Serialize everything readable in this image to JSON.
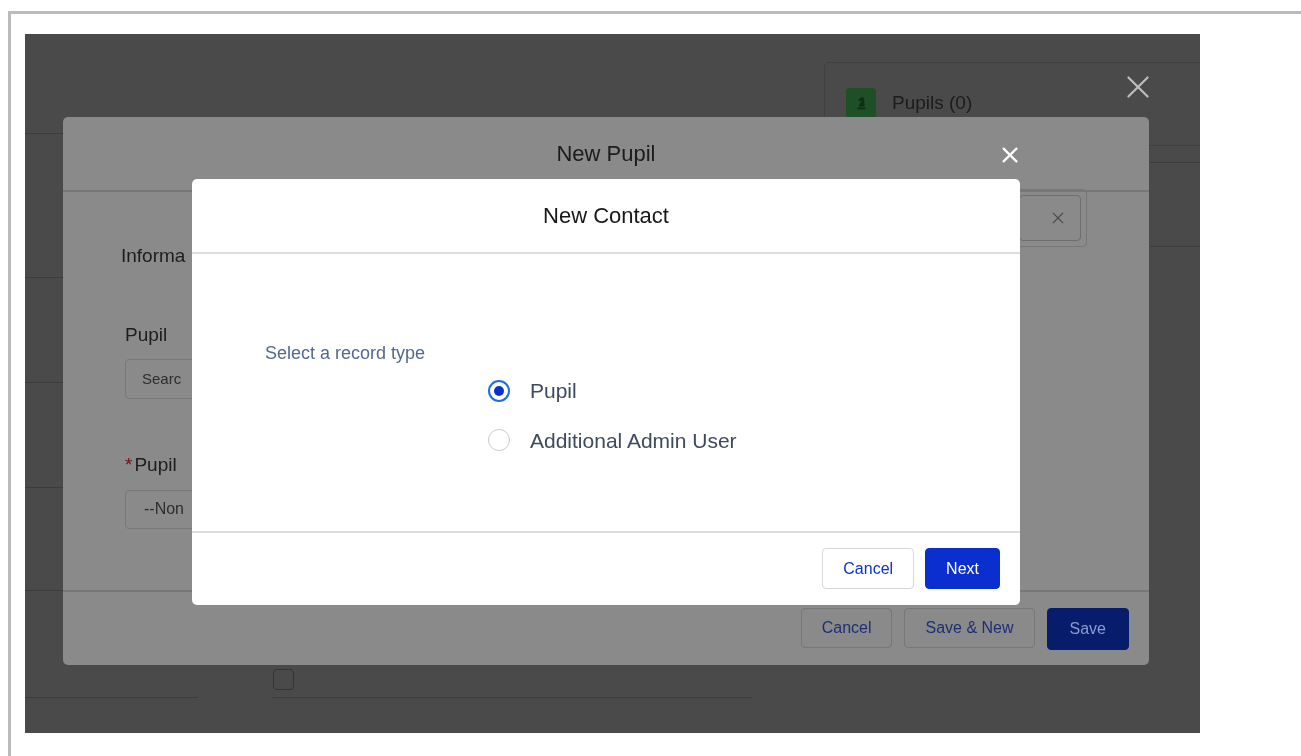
{
  "background_page": {
    "panel": {
      "title": "Pupils (0)"
    },
    "checkbox": {
      "checked": false
    }
  },
  "outer_modal": {
    "title": "New Pupil",
    "section": "Informa",
    "fields": [
      {
        "kind": "lookup",
        "label": "Pupil",
        "placeholder": "Searc"
      },
      {
        "kind": "select",
        "required_mark": "*",
        "label": "Pupil",
        "value": "--Non"
      }
    ],
    "buttons": [
      {
        "label": "Cancel",
        "kind": "neutral"
      },
      {
        "label": "Save & New",
        "kind": "neutral"
      },
      {
        "label": "Save",
        "kind": "brand"
      }
    ]
  },
  "dialog": {
    "title": "New Contact",
    "prompt": "Select a record type",
    "options": [
      {
        "label": "Pupil",
        "selected": true
      },
      {
        "label": "Additional Admin User",
        "selected": false
      }
    ],
    "buttons": [
      {
        "label": "Cancel",
        "kind": "neutral"
      },
      {
        "label": "Next",
        "kind": "brand"
      }
    ]
  }
}
